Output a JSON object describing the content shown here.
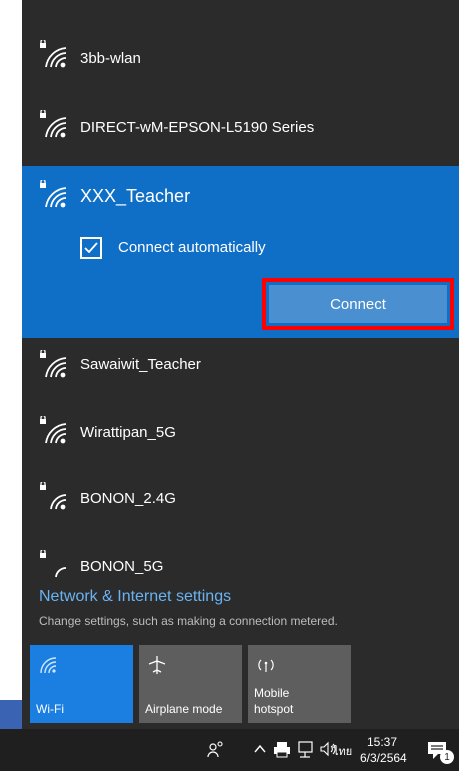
{
  "networks": [
    {
      "name": "3bb-wlan",
      "icon": "wifi-secured-icon"
    },
    {
      "name": "DIRECT-wM-EPSON-L5190 Series",
      "icon": "wifi-secured-icon"
    },
    {
      "name": "XXX_Teacher",
      "icon": "wifi-secured-icon",
      "selected": true,
      "connect_automatically_label": "Connect automatically",
      "connect_automatically_checked": true,
      "connect_label": "Connect"
    },
    {
      "name": "Sawaiwit_Teacher",
      "icon": "wifi-secured-icon"
    },
    {
      "name": "Wirattipan_5G",
      "icon": "wifi-secured-icon"
    },
    {
      "name": "BONON_2.4G",
      "icon": "wifi-secured-icon"
    },
    {
      "name": "BONON_5G",
      "icon": "wifi-secured-icon"
    }
  ],
  "settings": {
    "link": "Network & Internet settings",
    "description": "Change settings, such as making a connection metered."
  },
  "quick_actions": [
    {
      "label": "Wi-Fi",
      "icon": "wifi-icon",
      "active": true
    },
    {
      "label": "Airplane mode",
      "icon": "airplane-icon",
      "active": false
    },
    {
      "label_line1": "Mobile",
      "label_line2": "hotspot",
      "icon": "hotspot-icon",
      "active": false
    }
  ],
  "taskbar": {
    "language": "ไทย",
    "time": "15:37",
    "date": "6/3/2564",
    "notification_count": "1"
  },
  "colors": {
    "flyout_bg": "#2b2b2b",
    "selected_bg": "#0f6fc6",
    "connect_button": "#4a8fcf",
    "highlight_border": "#ff0000",
    "link": "#6ab3f3"
  }
}
